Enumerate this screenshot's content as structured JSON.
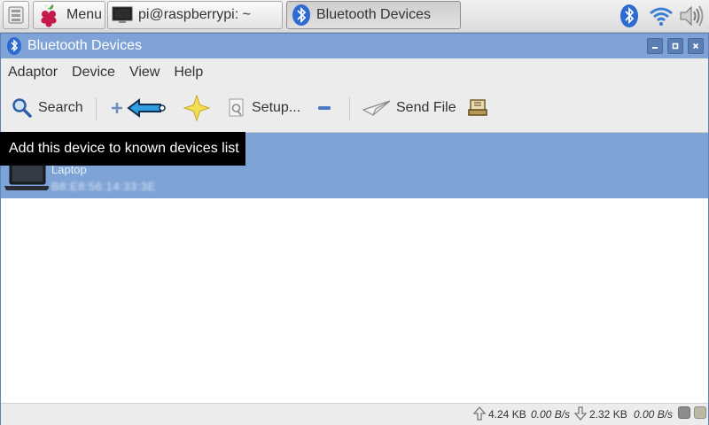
{
  "taskbar": {
    "menu_label": "Menu",
    "terminal_label": "pi@raspberrypi: ~",
    "bluetooth_window_label": "Bluetooth Devices",
    "icons": [
      "file-manager-icon",
      "raspberry-icon",
      "terminal-icon",
      "bluetooth-icon",
      "wifi-icon",
      "volume-icon"
    ]
  },
  "window": {
    "title": "Bluetooth Devices",
    "controls": [
      "minimize",
      "maximize",
      "close"
    ]
  },
  "menubar": {
    "items": [
      "Adaptor",
      "Device",
      "View",
      "Help"
    ]
  },
  "toolbar": {
    "search_label": "Search",
    "setup_label": "Setup...",
    "send_file_label": "Send File"
  },
  "tooltip": {
    "text": "Add this device to known devices list"
  },
  "devices": [
    {
      "name": "Laptop",
      "address": "B8:E8:56:14:33:3E",
      "icon": "laptop-icon",
      "selected": true
    }
  ],
  "statusbar": {
    "upload_total": "4.24 KB",
    "upload_rate": "0.00 B/s",
    "download_total": "2.32 KB",
    "download_rate": "0.00 B/s"
  },
  "colors": {
    "titlebar": "#7fa3d6",
    "selection": "#7ea3d6",
    "tooltip_bg": "#000000"
  }
}
